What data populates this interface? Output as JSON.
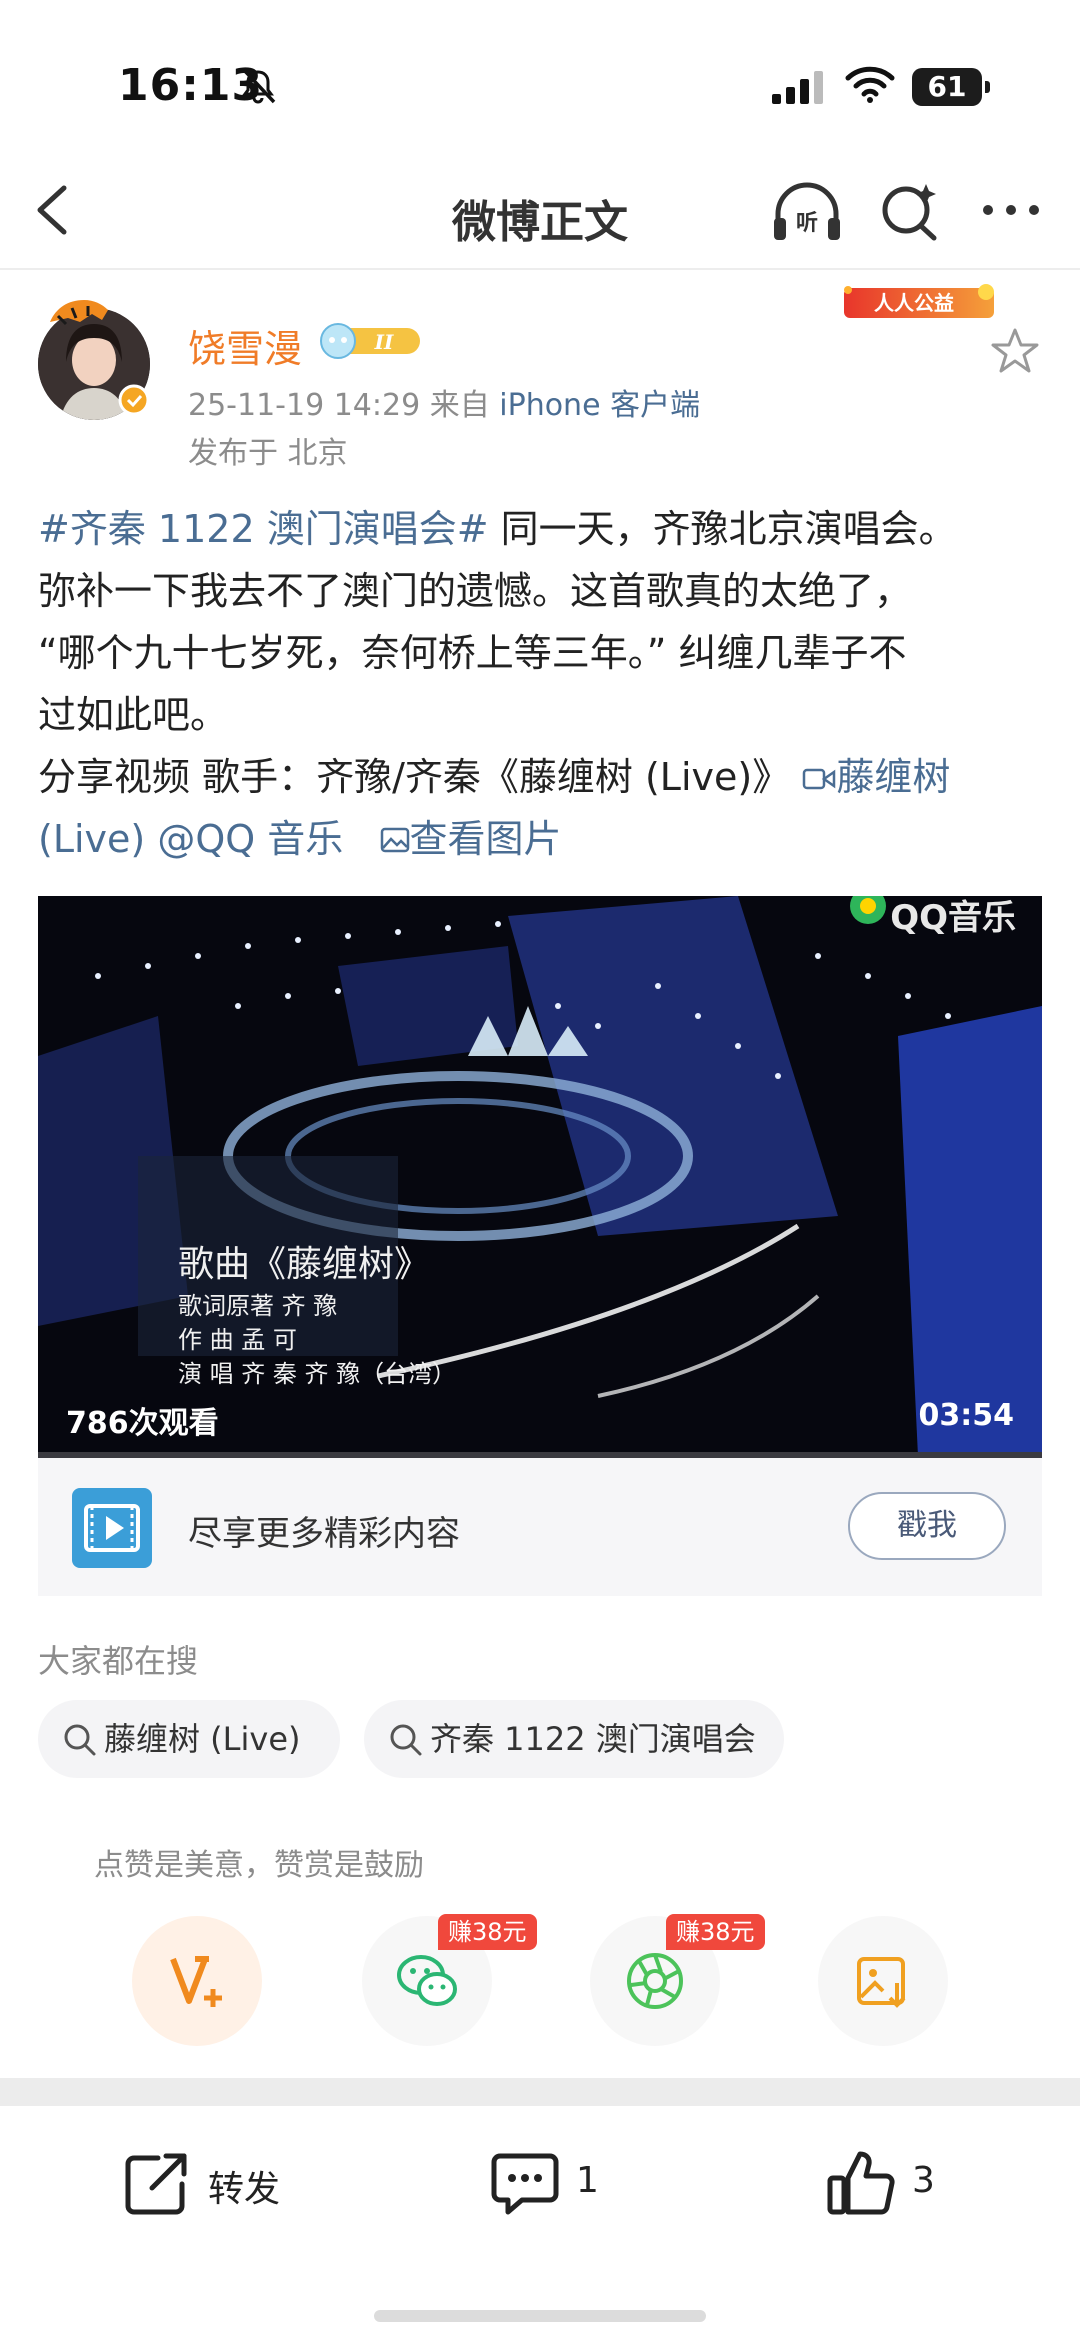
{
  "status_bar": {
    "time": "16:13",
    "battery": "61"
  },
  "nav": {
    "title": "微博正文"
  },
  "author": {
    "name": "饶雪漫",
    "timestamp": "25-11-19 14:29",
    "source_prefix": "来自",
    "source": "iPhone 客户端",
    "location": "发布于 北京",
    "charity_badge": "人人公益"
  },
  "post": {
    "hashtag": "#齐秦 1122 澳门演唱会#",
    "text_line1": " 同一天，齐豫北京演唱会。",
    "text_line2": "弥补一下我去不了澳门的遗憾。这首歌真的太绝了，",
    "text_line3": "“哪个九十七岁死，奈何桥上等三年。” 纠缠几辈子不",
    "text_line4": "过如此吧。",
    "share_prefix": "分享视频 歌手：齐豫/齐秦《藤缠树 (Live)》",
    "video_link": "藤缠树",
    "video_link_cont": "(Live) @QQ 音乐",
    "view_image": "查看图片"
  },
  "video": {
    "watermark": "QQ音乐",
    "views": "786次观看",
    "duration": "03:54",
    "subtitle_title": "歌曲《藤缠树》",
    "subtitle_lyric": "歌词原著  齐 豫",
    "subtitle_composer": "作  曲  孟 可",
    "subtitle_singer": "演  唱  齐 秦  齐 豫（台湾）"
  },
  "promo": {
    "text": "尽享更多精彩内容",
    "button": "戳我"
  },
  "searches": {
    "title": "大家都在搜",
    "items": [
      "藤缠树 (Live)",
      "齐秦 1122 澳门演唱会"
    ]
  },
  "reward": {
    "hint": "点赞是美意，赞赏是鼓励",
    "earn_badges": [
      "赚38元",
      "赚38元"
    ]
  },
  "actions": {
    "repost": "转发",
    "comments": "1",
    "likes": "3"
  },
  "colors": {
    "accent_orange": "#f07c28",
    "link_blue": "#4a6d93",
    "earn_red": "#f0483c"
  }
}
